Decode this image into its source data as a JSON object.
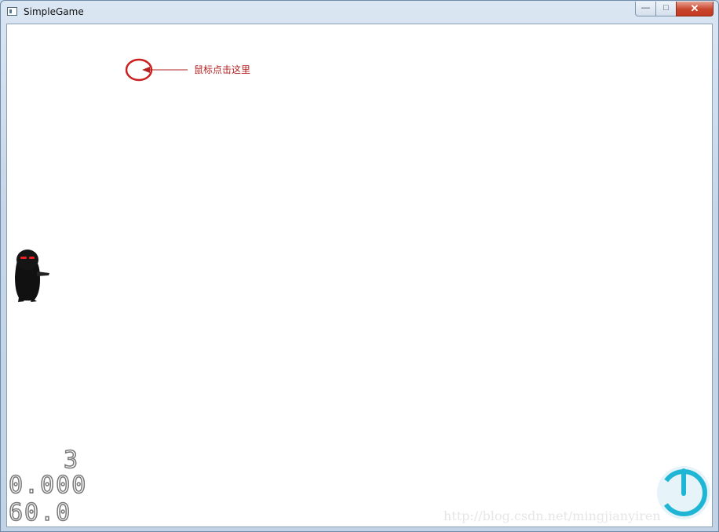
{
  "window": {
    "title": "SimpleGame",
    "minimize_label": "—",
    "maximize_label": "□",
    "close_label": "✕"
  },
  "scene": {
    "hint_text": "鼠标点击这里",
    "hint_color": "#b22222",
    "player_icon": "ninja-sprite",
    "power_icon": "power-icon"
  },
  "hud": {
    "count": "3",
    "time": "0.000",
    "fps": "60.0"
  },
  "watermark": "http://blog.csdn.net/mingjianyiren"
}
